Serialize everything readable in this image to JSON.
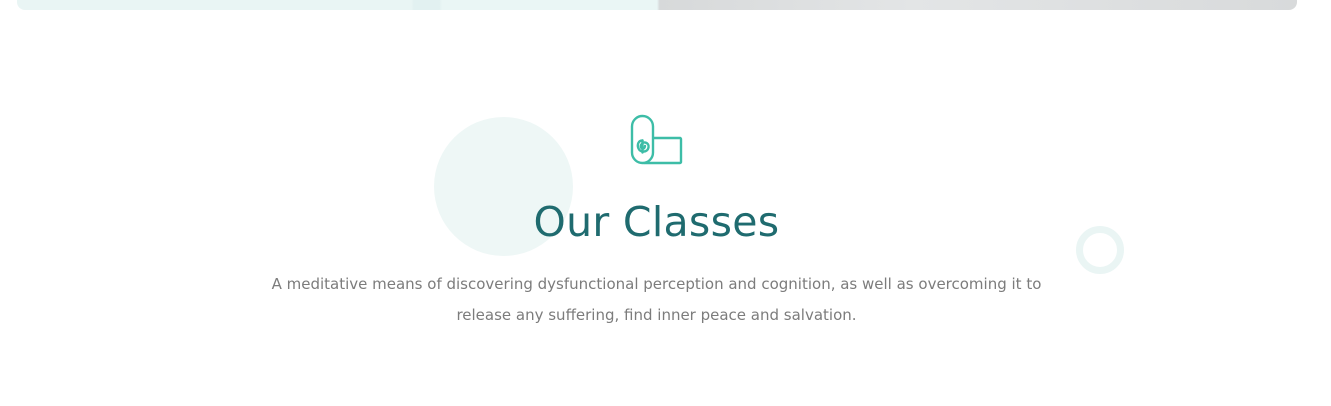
{
  "section": {
    "title": "Our Classes",
    "description": "A meditative means of discovering dysfunctional perception and cognition, as well as overcoming it to release any suffering, find inner peace and salvation.",
    "icon": "yoga-mat-icon"
  },
  "colors": {
    "accent": "#3dbda7",
    "title": "#1f6b6f",
    "text": "#7c7c7c",
    "deco": "#eef7f6"
  }
}
